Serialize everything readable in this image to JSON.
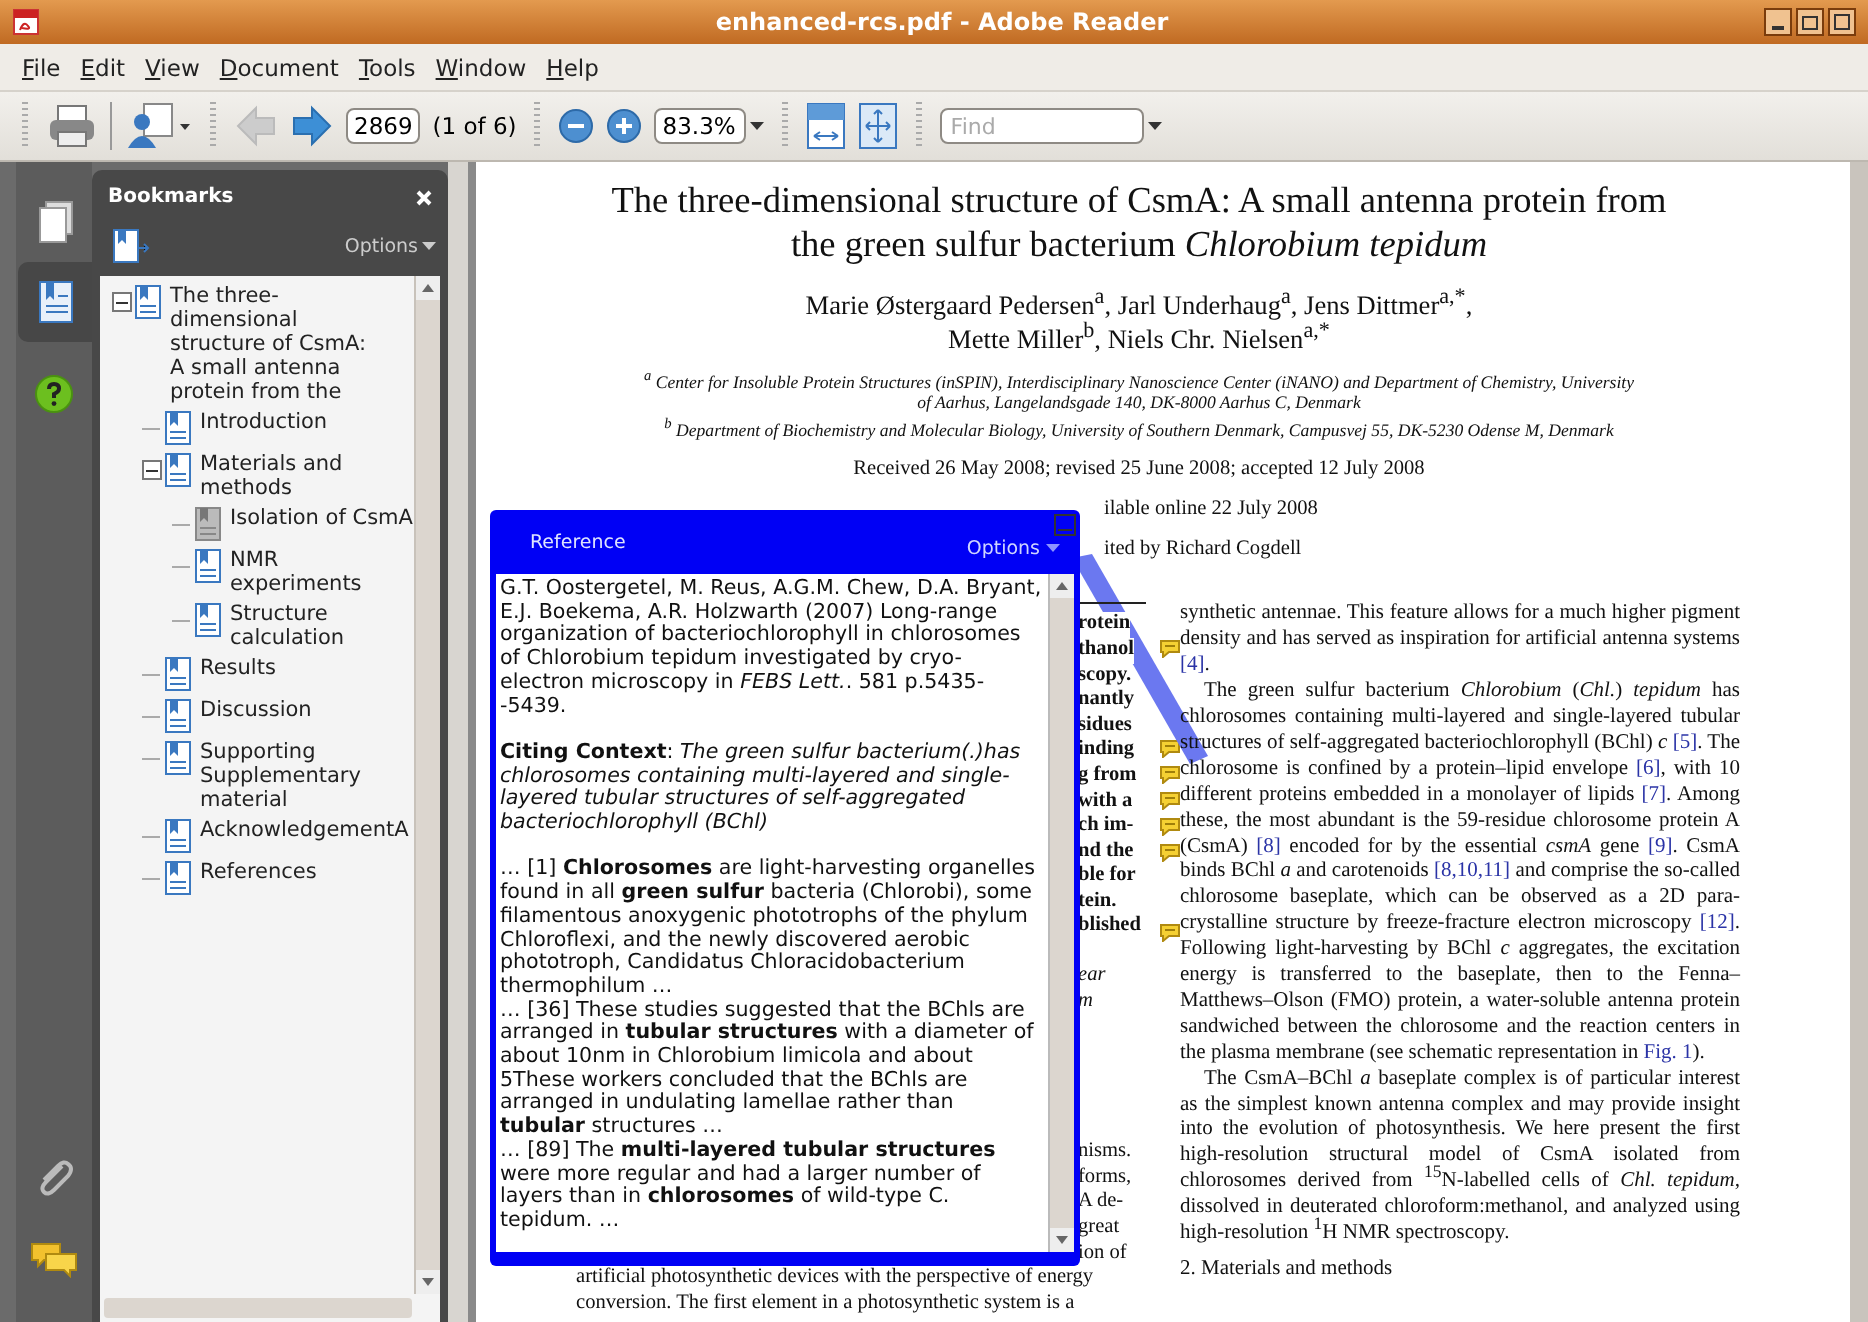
{
  "window": {
    "title": "enhanced-rcs.pdf - Adobe Reader"
  },
  "menu": [
    "File",
    "Edit",
    "View",
    "Document",
    "Tools",
    "Window",
    "Help"
  ],
  "toolbar": {
    "page_number": "2869",
    "page_count": "(1 of 6)",
    "zoom": "83.3%",
    "find": {
      "placeholder": "Find"
    }
  },
  "side_tabs": [
    {
      "kind": "pages",
      "selected": false
    },
    {
      "kind": "bookmarks",
      "selected": true
    }
  ],
  "bookmarks": {
    "title": "Bookmarks",
    "options": "Options",
    "items": [
      {
        "label": "The three-dimensional structure of CsmA: A small antenna protein  from the",
        "greyed": false,
        "expanded": true,
        "children": [
          {
            "label": "Introduction",
            "greyed": false
          },
          {
            "label": "Materials and methods",
            "greyed": false,
            "expanded": true,
            "children": [
              {
                "label": "Isolation of CsmA",
                "greyed": true
              },
              {
                "label": "NMR experiments",
                "greyed": false
              },
              {
                "label": "Structure calculation",
                "greyed": false
              }
            ]
          },
          {
            "label": "Results",
            "greyed": false
          },
          {
            "label": "Discussion",
            "greyed": false
          },
          {
            "label": "Supporting Supplementary material",
            "greyed": false
          },
          {
            "label": "AcknowledgementA",
            "greyed": false
          },
          {
            "label": "References",
            "greyed": false
          }
        ]
      }
    ]
  },
  "document": {
    "title": "The three-dimensional structure of CsmA: A small antenna protein from the green sulfur bacterium *Chlorobium tepidum*",
    "authors": "Marie Østergaard Pedersen$^{a}$, Jarl Underhaug$^{a}$, Jens Dittmer$^{a,*}$, Mette Miller$^{b}$, Niels Chr. Nielsen$^{a,*}$",
    "affiliations": [
      "$^{a}$ Center for Insoluble Protein Structures (inSPIN), Interdisciplinary Nanoscience Center (iNANO) and Department of Chemistry, University of Aarhus, Langelandsgade 140, DK-8000 Aarhus C, Denmark",
      "$^{b}$ Department of Biochemistry and Molecular Biology, University of Southern Denmark, Campusvej 55, DK-5230 Odense M, Denmark"
    ],
    "received": "Received 26 May 2008; revised 25 June 2008; accepted 12 July 2008",
    "partial_lines": [
      "ilable online 22 July 2008",
      "ited by Richard Cogdell"
    ],
    "left_column": {
      "fragment_blocks": [
        [
          "rotein",
          "thanol",
          "scopy.",
          "nantly",
          "sidues",
          "inding",
          "g from",
          "with a",
          "ch im-",
          "nd the",
          "ble for",
          "tein.",
          "blished"
        ],
        [
          "ear",
          "m"
        ],
        [
          "nisms.",
          "forms,",
          "A de-",
          "great",
          "ion of"
        ]
      ],
      "lines": [
        "artificial photosynthetic devices with the perspective of energy",
        "conversion. The first element in a photosynthetic system is a"
      ]
    },
    "right_column": {
      "paragraphs": [
        [
          {
            "kind": "text",
            "t": "synthetic antennae. This feature allows for a much higher pigment density and has served as inspiration for artificial antenna systems "
          },
          {
            "kind": "link",
            "t": "[4]"
          },
          {
            "kind": "text",
            "t": "."
          }
        ],
        [
          {
            "kind": "text",
            "t": "The green sulfur bacterium *Chlorobium* (*Chl.*) *tepidum* has chlorosomes containing multi-layered and single-layered tubular structures of self-aggregated bacteriochlorophyll (BChl) *c* "
          },
          {
            "kind": "link",
            "t": "[5]"
          },
          {
            "kind": "text",
            "t": ". The chlorosome is confined by a protein–lipid envelope "
          },
          {
            "kind": "link",
            "t": "[6]"
          },
          {
            "kind": "text",
            "t": ", with 10 different proteins embedded in a monolayer of lipids "
          },
          {
            "kind": "link",
            "t": "[7]"
          },
          {
            "kind": "text",
            "t": ". Among these, the most abundant is the 59-residue chlorosome protein A (CsmA) "
          },
          {
            "kind": "link",
            "t": "[8]"
          },
          {
            "kind": "text",
            "t": " encoded for by the essential *csmA* gene "
          },
          {
            "kind": "link",
            "t": "[9]"
          },
          {
            "kind": "text",
            "t": ". CsmA binds BChl *a* and carotenoids "
          },
          {
            "kind": "link",
            "t": "[8,10,11]"
          },
          {
            "kind": "text",
            "t": " and comprise the so-called chlorosome baseplate, which can be observed as a 2D para-crystalline structure by freeze-fracture electron microscopy "
          },
          {
            "kind": "link",
            "t": "[12]"
          },
          {
            "kind": "text",
            "t": ". Following light-harvesting by BChl *c* aggregates, the excitation energy is transferred to the baseplate, then to the Fenna–Matthews–Olson (FMO) protein, a water-soluble antenna protein sandwiched between the chlorosome and the reaction centers in the plasma membrane (see schematic representation in "
          },
          {
            "kind": "link",
            "t": "Fig. 1"
          },
          {
            "kind": "text",
            "t": ")."
          }
        ],
        [
          {
            "kind": "text",
            "t": "The CsmA–BChl *a* baseplate complex is of particular interest as the simplest known antenna complex and may provide insight into the evolution of photosynthesis. We here present the first high-resolution structural model of CsmA isolated from chlorosomes derived from $^{15}$N-labelled cells of *Chl. tepidum*, dissolved in deuterated chloroform:methanol, and analyzed using high-resolution $^{1}$H NMR spectroscopy."
          }
        ]
      ],
      "heading": "2. Materials and methods"
    }
  },
  "popup": {
    "title": "Reference",
    "options": "Options",
    "reference": "G.T. Oostergetel, M. Reus, A.G.M. Chew, D.A. Bryant, E.J. Boekema, A.R. Holzwarth (2007) Long-range organization of bacteriochlorophyll in chlorosomes of Chlorobium tepidum investigated by cryo-electron microscopy in *FEBS Lett.*.  581 p.5435--5439.",
    "context": "**Citing Context**: *The green sulfur bacterium(.)has chlorosomes containing multi-layered and single-layered tubular structures of self-aggregated bacteriochlorophyll (BChl)*",
    "excerpts": [
      "… [1]  **Chlorosomes** are light-harvesting organelles found in all **green sulfur** bacteria (Chlorobi), some filamentous anoxygenic phototrophs of the phylum Chloroflexi, and the newly discovered aerobic phototroph, Candidatus Chloracidobacterium thermophilum …",
      "… [36]  These studies suggested that the BChls are arranged in **tubular structures** with a diameter of about 10nm in Chlorobium limicola and about 5These workers concluded that the BChls are arranged in undulating lamellae rather than **tubular** structures …",
      "… [89]  The **multi-layered tubular structures** were more regular and had a larger number of layers than in **chlorosomes** of wild-type C. tepidum. …"
    ]
  }
}
